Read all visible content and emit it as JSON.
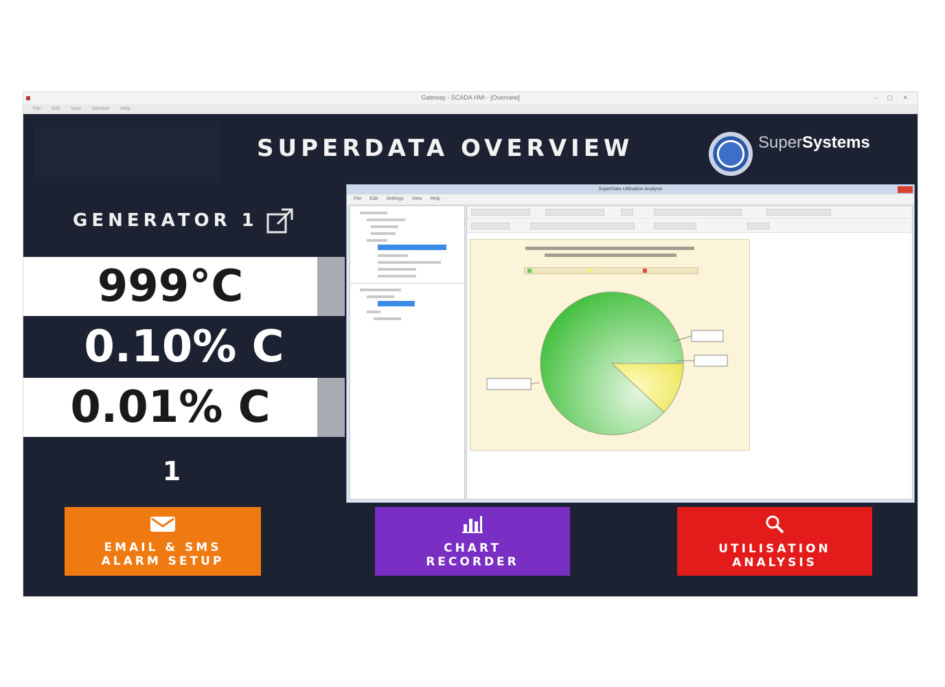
{
  "window": {
    "title": "Gateway - SCADA HMI - [Overview]",
    "menu": [
      "File",
      "Edit",
      "View",
      "Window",
      "Help"
    ]
  },
  "header": {
    "title": "SUPERDATA OVERVIEW",
    "brand_light": "Super",
    "brand_bold": "Systems"
  },
  "generator": {
    "title": "GENERATOR 1",
    "temperature": "999°C",
    "carbon_1": "0.10% C",
    "carbon_2": "0.01% C",
    "counter": "1"
  },
  "embedded_app": {
    "title": "SuperData Utilisation Analysis",
    "menu": [
      "File",
      "Edit",
      "Settings",
      "View",
      "Help"
    ],
    "chart_data": {
      "type": "pie",
      "values": [
        88,
        12
      ],
      "colors": [
        "#5fce5a",
        "#f5f27a"
      ]
    }
  },
  "actions": {
    "email": {
      "line1": "EMAIL & SMS",
      "line2": "ALARM SETUP"
    },
    "chart": {
      "line1": "CHART",
      "line2": "RECORDER"
    },
    "util": {
      "line1": "UTILISATION",
      "line2": "ANALYSIS"
    }
  },
  "colors": {
    "background": "#1c2232",
    "email": "#f07a12",
    "chart": "#7a2fc4",
    "util": "#e31b1b"
  }
}
